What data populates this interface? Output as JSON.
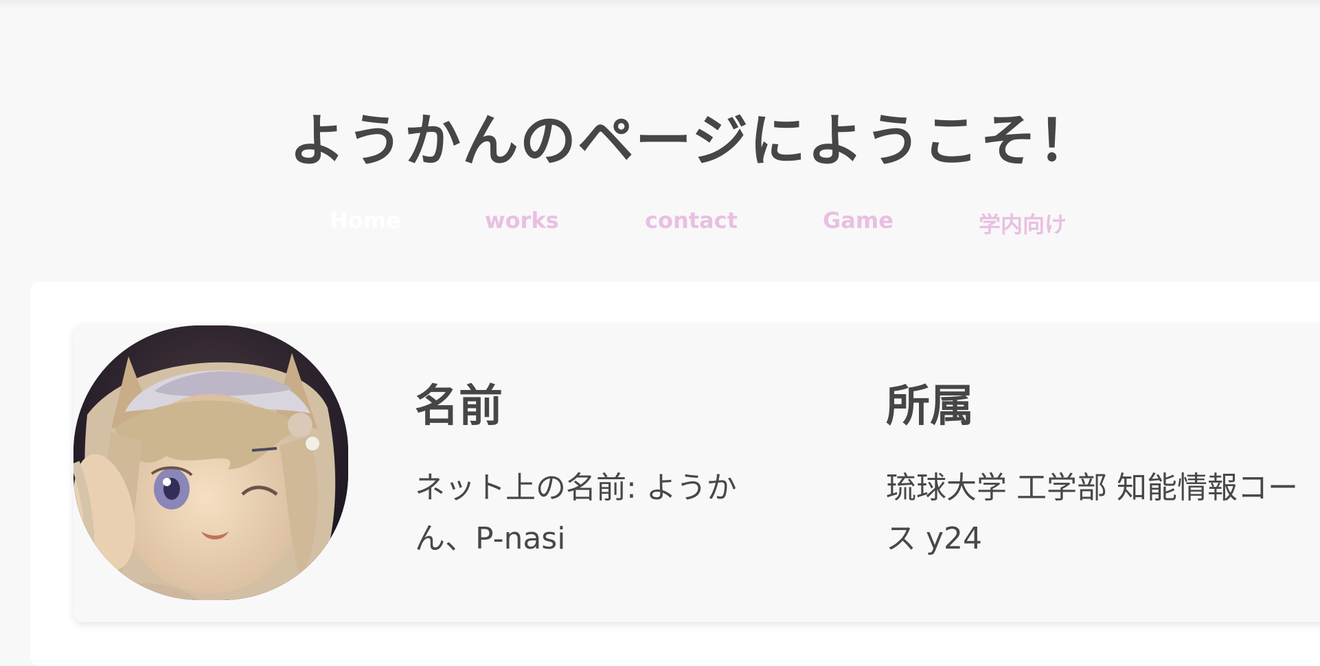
{
  "header": {
    "title": "ようかんのページにようこそ！"
  },
  "nav": {
    "items": [
      {
        "label": "Home",
        "active": true
      },
      {
        "label": "works",
        "active": false
      },
      {
        "label": "contact",
        "active": false
      },
      {
        "label": "Game",
        "active": false
      },
      {
        "label": "学内向け",
        "active": false
      }
    ]
  },
  "profile": {
    "avatar_icon": "anime-avatar-image",
    "name": {
      "heading": "名前",
      "text": "ネット上の名前: ようかん、P-nasi"
    },
    "affiliation": {
      "heading": "所属",
      "text": "琉球大学 工学部 知能情報コース y24"
    }
  },
  "colors": {
    "background": "#f8f8f8",
    "text": "#484848",
    "nav_link": "#e9bfe2",
    "nav_active": "#ffffff",
    "card": "#ffffff"
  }
}
